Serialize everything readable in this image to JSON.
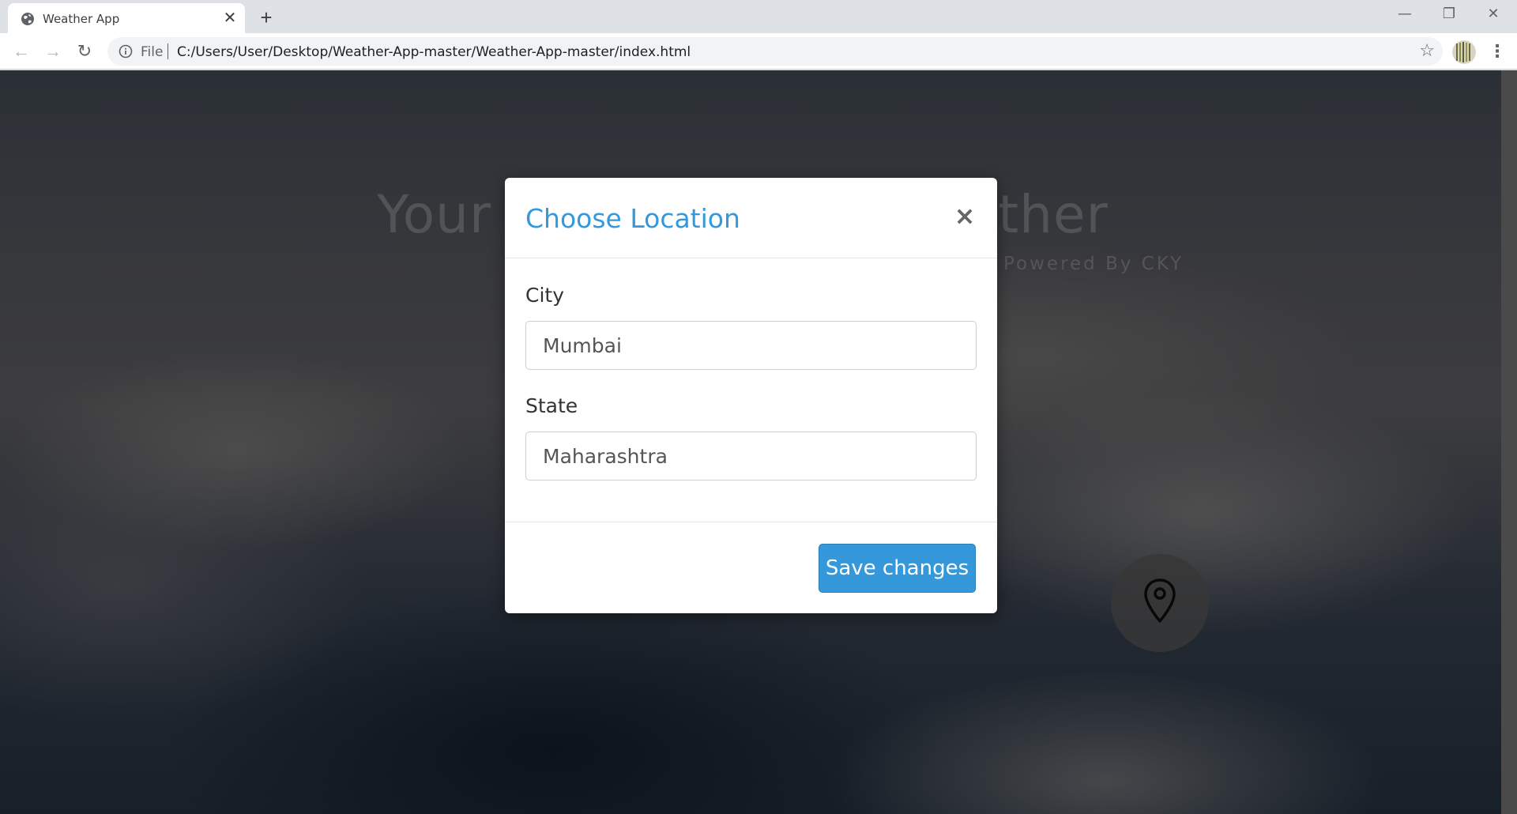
{
  "browser": {
    "tab_title": "Weather App",
    "tab_close": "✕",
    "new_tab": "+",
    "window_controls": {
      "minimize": "—",
      "restore": "❐",
      "close": "✕"
    },
    "nav": {
      "back": "←",
      "forward": "→",
      "reload": "↻"
    },
    "scheme_label": "File",
    "url": "C:/Users/User/Desktop/Weather-App-master/Weather-App-master/index.html",
    "bookmark_star": "☆",
    "menu": "⋮"
  },
  "page": {
    "hero_title": "Your Daily Dose of Weather",
    "hero_subtitle": "Powered By CKY"
  },
  "modal": {
    "title": "Choose Location",
    "close_glyph": "×",
    "city_label": "City",
    "city_value": "Mumbai",
    "state_label": "State",
    "state_value": "Maharashtra",
    "save_label": "Save changes"
  },
  "colors": {
    "accent": "#3498db",
    "tabstrip": "#dee1e6",
    "backdrop": "rgba(0,0,0,0.5)"
  },
  "icons": {
    "favicon": "globe-icon",
    "info": "info-icon",
    "star": "star-icon",
    "extension": "extension-icon",
    "location": "map-pin-icon"
  }
}
